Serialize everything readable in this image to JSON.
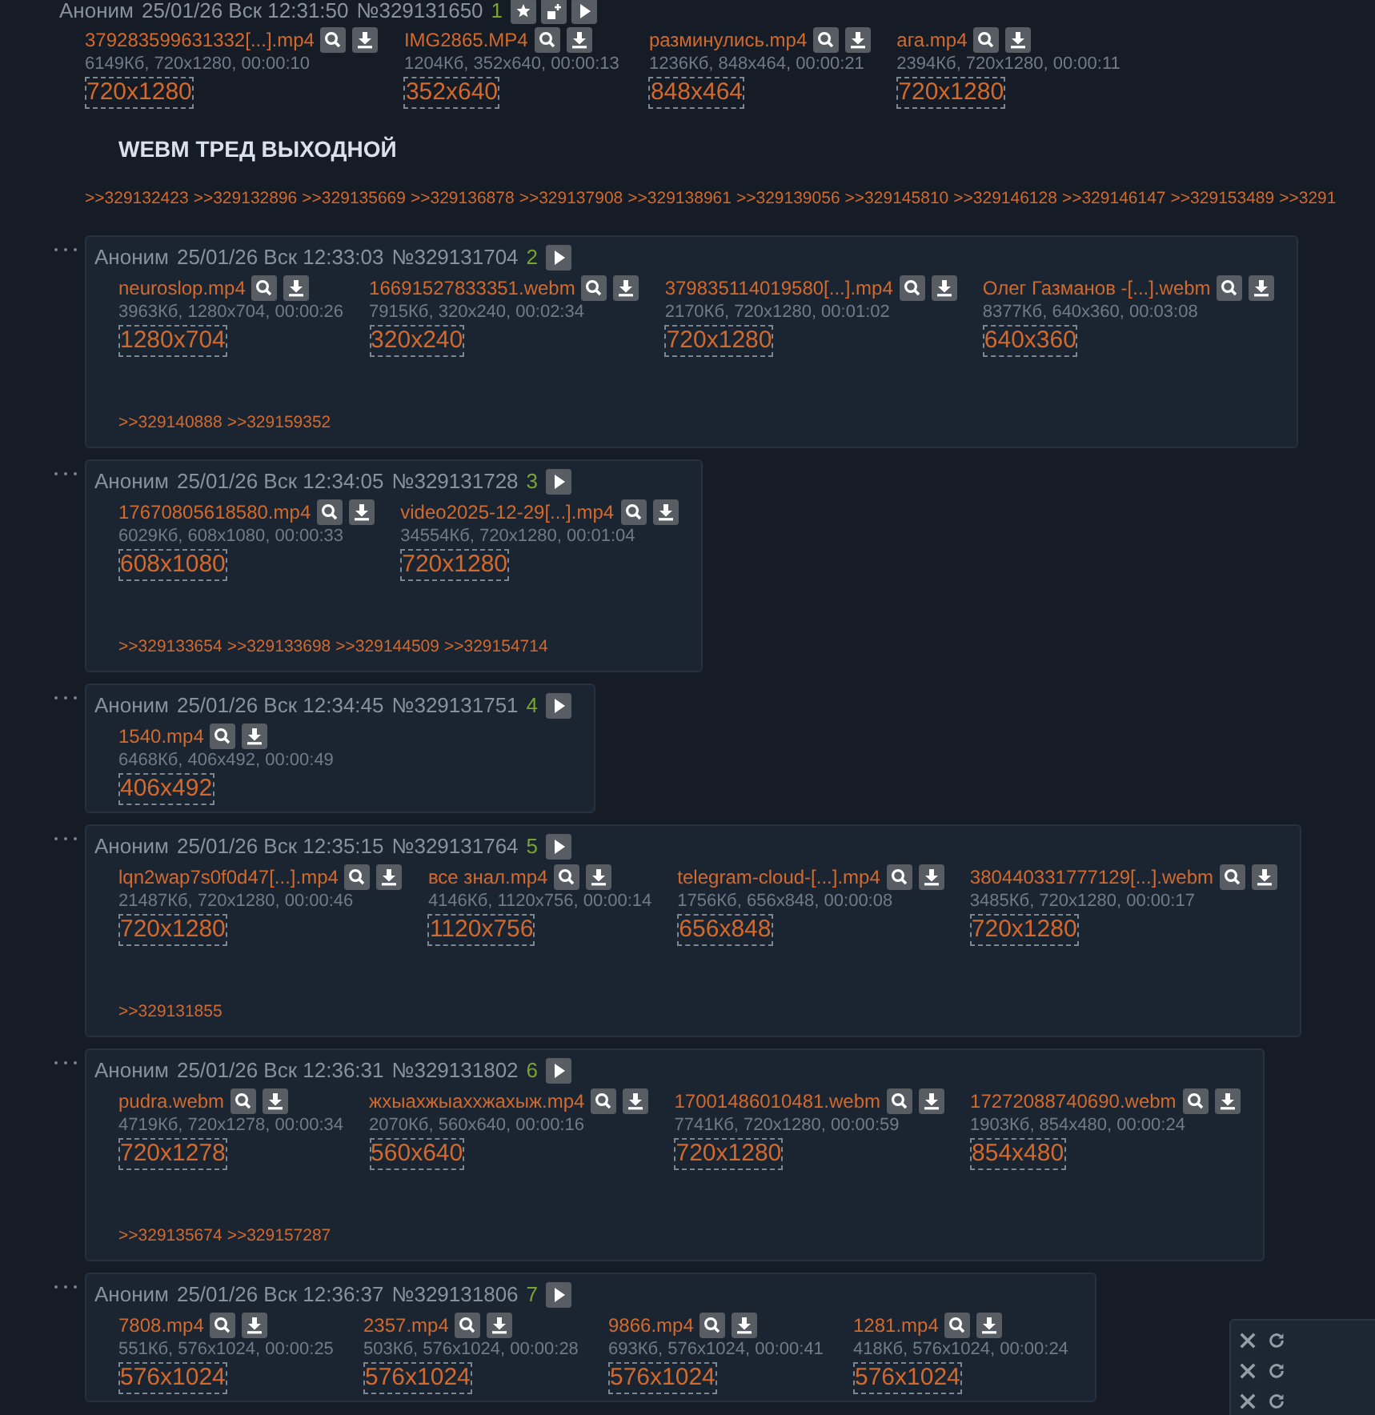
{
  "posts": [
    {
      "kind": "op",
      "author": "Аноним",
      "date": "25/01/26 Вск 12:31:50",
      "number": "№329131650",
      "index": "1",
      "files": [
        {
          "name": "379283599631332[...].mp4",
          "info": "6149Кб, 720x1280, 00:00:10",
          "thumb": "720x1280"
        },
        {
          "name": "IMG2865.MP4",
          "info": "1204Кб, 352x640, 00:00:13",
          "thumb": "352x640"
        },
        {
          "name": "разминулись.mp4",
          "info": "1236Кб, 848x464, 00:00:21",
          "thumb": "848x464"
        },
        {
          "name": "ага.mp4",
          "info": "2394Кб, 720x1280, 00:00:11",
          "thumb": "720x1280"
        }
      ],
      "subject": "WEBM ТРЕД ВЫХОДНОЙ",
      "replies": [
        ">>329132423",
        ">>329132896",
        ">>329135669",
        ">>329136878",
        ">>329137908",
        ">>329138961",
        ">>329139056",
        ">>329145810",
        ">>329146128",
        ">>329146147",
        ">>329153489",
        ">>3291"
      ]
    },
    {
      "kind": "reply",
      "author": "Аноним",
      "date": "25/01/26 Вск 12:33:03",
      "number": "№329131704",
      "index": "2",
      "files": [
        {
          "name": "neuroslop.mp4",
          "info": "3963Кб, 1280x704, 00:00:26",
          "thumb": "1280x704"
        },
        {
          "name": "16691527833351.webm",
          "info": "7915Кб, 320x240, 00:02:34",
          "thumb": "320x240"
        },
        {
          "name": "379835114019580[...].mp4",
          "info": "2170Кб, 720x1280, 00:01:02",
          "thumb": "720x1280"
        },
        {
          "name": "Олег Газманов -[...].webm",
          "info": "8377Кб, 640x360, 00:03:08",
          "thumb": "640x360"
        }
      ],
      "replies": [
        ">>329140888",
        ">>329159352"
      ]
    },
    {
      "kind": "reply",
      "author": "Аноним",
      "date": "25/01/26 Вск 12:34:05",
      "number": "№329131728",
      "index": "3",
      "files": [
        {
          "name": "17670805618580.mp4",
          "info": "6029Кб, 608x1080, 00:00:33",
          "thumb": "608x1080"
        },
        {
          "name": "video2025-12-29[...].mp4",
          "info": "34554Кб, 720x1280, 00:01:04",
          "thumb": "720x1280"
        }
      ],
      "replies": [
        ">>329133654",
        ">>329133698",
        ">>329144509",
        ">>329154714"
      ]
    },
    {
      "kind": "reply",
      "author": "Аноним",
      "date": "25/01/26 Вск 12:34:45",
      "number": "№329131751",
      "index": "4",
      "files": [
        {
          "name": "1540.mp4",
          "info": "6468Кб, 406x492, 00:00:49",
          "thumb": "406x492"
        }
      ]
    },
    {
      "kind": "reply",
      "author": "Аноним",
      "date": "25/01/26 Вск 12:35:15",
      "number": "№329131764",
      "index": "5",
      "files": [
        {
          "name": "lqn2wap7s0f0d47[...].mp4",
          "info": "21487Кб, 720x1280, 00:00:46",
          "thumb": "720x1280"
        },
        {
          "name": "все знал.mp4",
          "info": "4146Кб, 1120x756, 00:00:14",
          "thumb": "1120x756"
        },
        {
          "name": "telegram-cloud-[...].mp4",
          "info": "1756Кб, 656x848, 00:00:08",
          "thumb": "656x848"
        },
        {
          "name": "380440331777129[...].webm",
          "info": "3485Кб, 720x1280, 00:00:17",
          "thumb": "720x1280"
        }
      ],
      "replies": [
        ">>329131855"
      ]
    },
    {
      "kind": "reply",
      "author": "Аноним",
      "date": "25/01/26 Вск 12:36:31",
      "number": "№329131802",
      "index": "6",
      "files": [
        {
          "name": "pudra.webm",
          "info": "4719Кб, 720x1278, 00:00:34",
          "thumb": "720x1278"
        },
        {
          "name": "жхыахжыаххжахыж.mp4",
          "info": "2070Кб, 560x640, 00:00:16",
          "thumb": "560x640"
        },
        {
          "name": "17001486010481.webm",
          "info": "7741Кб, 720x1280, 00:00:59",
          "thumb": "720x1280"
        },
        {
          "name": "17272088740690.webm",
          "info": "1903Кб, 854x480, 00:00:24",
          "thumb": "854x480"
        }
      ],
      "replies": [
        ">>329135674",
        ">>329157287"
      ]
    },
    {
      "kind": "reply",
      "author": "Аноним",
      "date": "25/01/26 Вск 12:36:37",
      "number": "№329131806",
      "index": "7",
      "files": [
        {
          "name": "7808.mp4",
          "info": "551Кб, 576x1024, 00:00:25",
          "thumb": "576x1024"
        },
        {
          "name": "2357.mp4",
          "info": "503Кб, 576x1024, 00:00:28",
          "thumb": "576x1024"
        },
        {
          "name": "9866.mp4",
          "info": "693Кб, 576x1024, 00:00:41",
          "thumb": "576x1024"
        },
        {
          "name": "1281.mp4",
          "info": "418Кб, 576x1024, 00:00:24",
          "thumb": "576x1024"
        }
      ]
    }
  ]
}
